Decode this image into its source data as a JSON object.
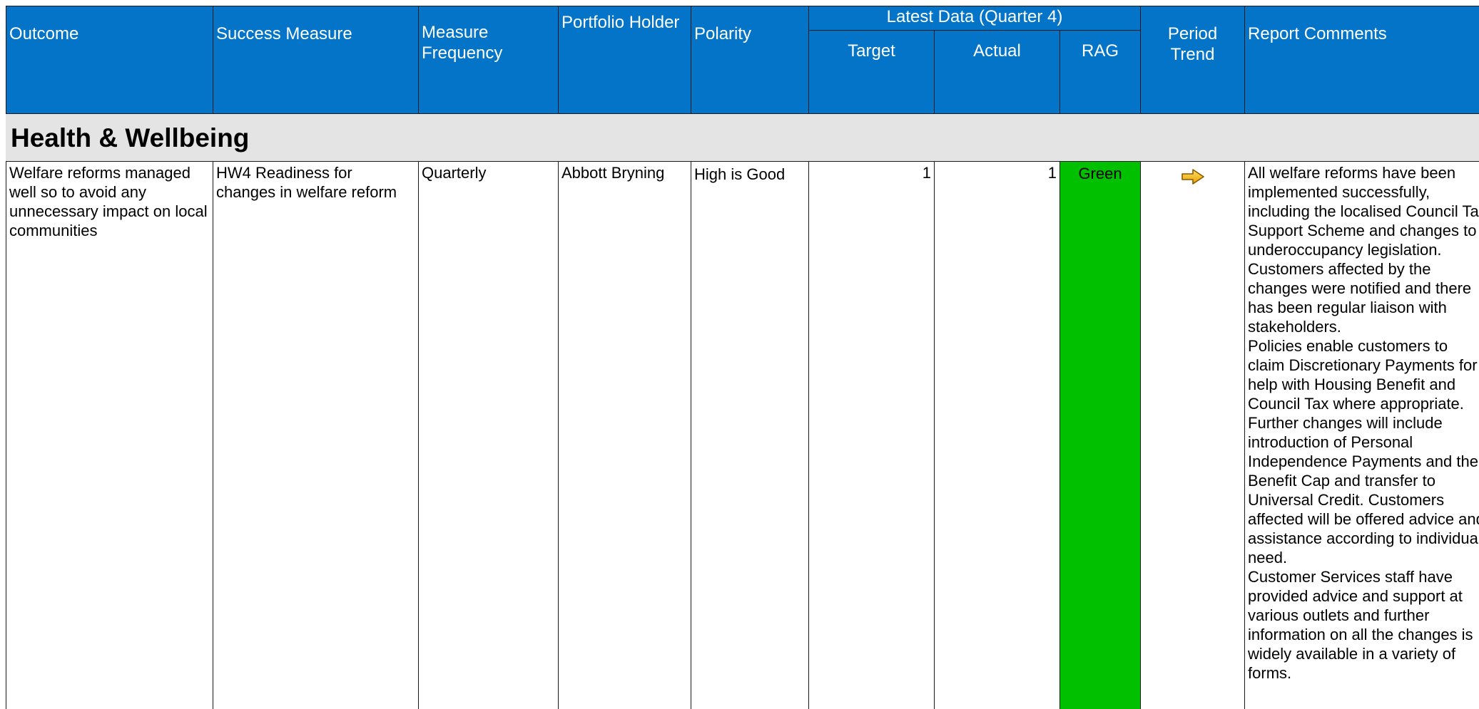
{
  "header": {
    "outcome": "Outcome",
    "success_measure": "Success Measure",
    "measure_frequency": "Measure Frequency",
    "portfolio_holder": "Portfolio Holder",
    "polarity": "Polarity",
    "latest_data": "Latest Data (Quarter 4)",
    "target": "Target",
    "actual": "Actual",
    "rag": "RAG",
    "period_trend": "Period Trend",
    "report_comments": "Report Comments"
  },
  "colors": {
    "header_bg": "#0474c8",
    "section_bg": "#e4e4e4",
    "rag_green": "#00c000",
    "trend_arrow": "#f5b800"
  },
  "section": {
    "title": "Health & Wellbeing"
  },
  "rows": [
    {
      "outcome": "Welfare reforms managed well so to avoid any unnecessary impact on local communities",
      "success_measure": "HW4 Readiness for changes in welfare reform",
      "measure_frequency": "Quarterly",
      "portfolio_holder": "Abbott Bryning",
      "polarity": "High is Good",
      "target": "1",
      "actual": "1",
      "rag": "Green",
      "trend_icon": "right-arrow-icon",
      "comments": [
        "All welfare reforms have been implemented successfully, including the localised Council Tax Support Scheme and changes to underoccupancy legislation. Customers affected by the changes were notified and there has been regular liaison with stakeholders.",
        "Policies enable customers to claim Discretionary Payments for help with Housing Benefit and Council Tax where appropriate.",
        "Further changes will include introduction of Personal Independence Payments and the Benefit Cap and transfer to Universal Credit. Customers affected will be offered advice and assistance according to individual need.",
        "Customer Services staff have provided advice and support at various outlets and further information on all the changes is widely available in a variety of forms."
      ]
    }
  ]
}
